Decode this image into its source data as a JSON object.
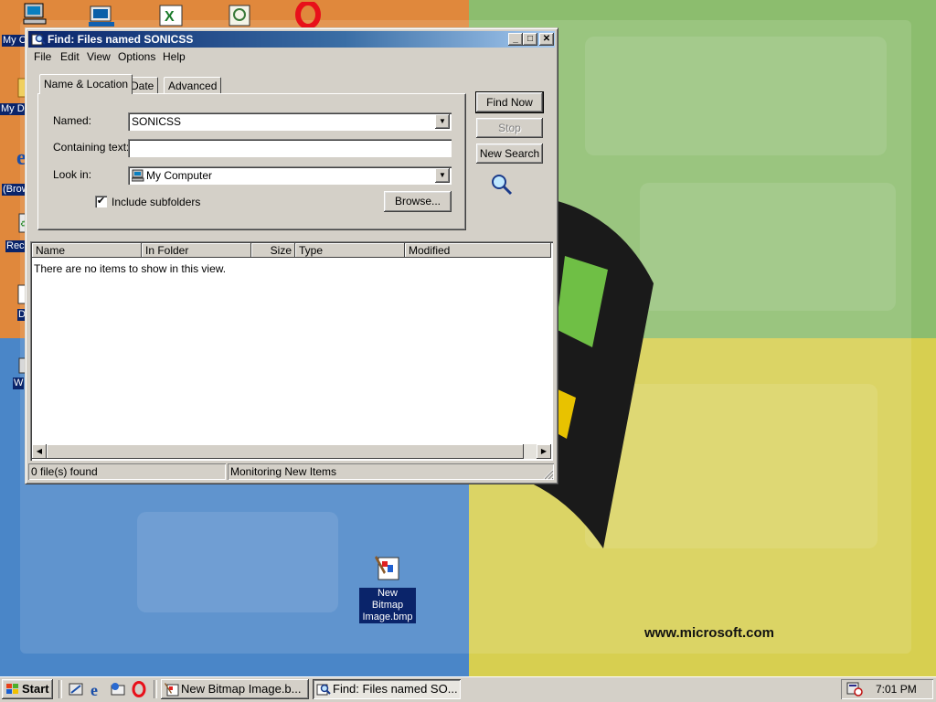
{
  "colors": {
    "title_active": "#0a246a",
    "face": "#d4d0c8",
    "wallpaper_orange": "#e0883c",
    "wallpaper_green": "#8cbd6e",
    "wallpaper_blue": "#4a86c8",
    "wallpaper_yellow": "#d7cf50"
  },
  "desktop": {
    "icon_labels": [
      "My C",
      "My D",
      "(Brow",
      "Rec",
      "D",
      "W"
    ],
    "file_icon": {
      "line1": "New Bitmap",
      "line2": "Image.bmp",
      "icon": "paint-bitmap-icon"
    },
    "wallpaper_url": "www.microsoft.com"
  },
  "window": {
    "title": "Find: Files named SONICSS",
    "menu": [
      "File",
      "Edit",
      "View",
      "Options",
      "Help"
    ],
    "tabs": [
      "Name & Location",
      "Date",
      "Advanced"
    ],
    "named_label": "Named:",
    "named_value": "SONICSS",
    "containing_label": "Containing text:",
    "containing_value": "",
    "lookin_label": "Look in:",
    "lookin_value": "My Computer",
    "include_subfolders": "Include subfolders",
    "browse_button": "Browse...",
    "find_now_button": "Find Now",
    "stop_button": "Stop",
    "new_search_button": "New Search",
    "columns": [
      "Name",
      "In Folder",
      "Size",
      "Type",
      "Modified"
    ],
    "empty_message": "There are no items to show in this view.",
    "status_left": "0 file(s) found",
    "status_right": "Monitoring New Items"
  },
  "taskbar": {
    "start_label": "Start",
    "tasks": [
      "New Bitmap Image.b...",
      "Find: Files named SO..."
    ],
    "clock": "7:01 PM"
  }
}
